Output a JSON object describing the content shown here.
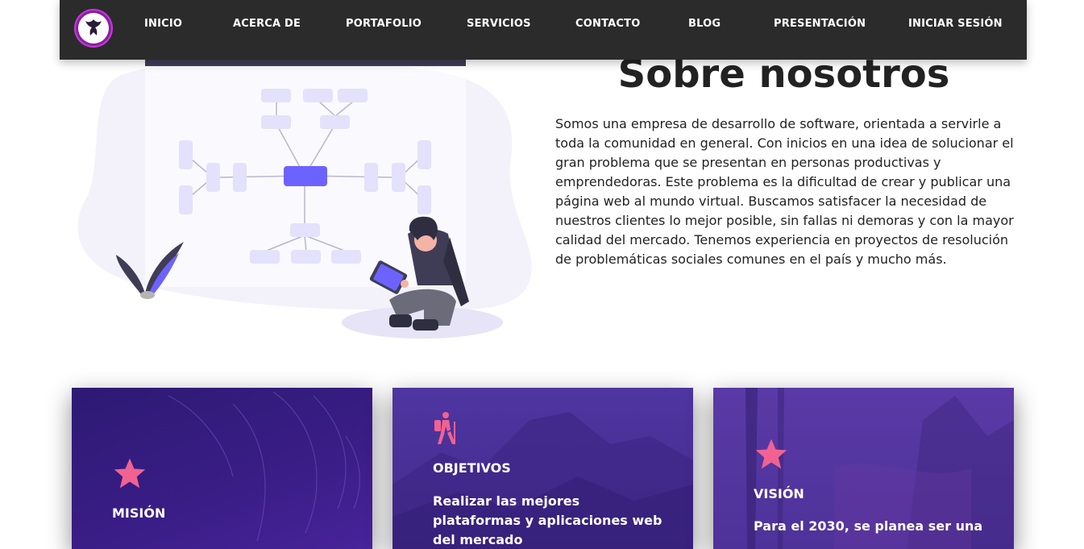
{
  "nav": {
    "items": [
      {
        "label": "INICIO"
      },
      {
        "label": "ACERCA DE"
      },
      {
        "label": "PORTAFOLIO"
      },
      {
        "label": "SERVICIOS"
      },
      {
        "label": "CONTACTO"
      },
      {
        "label": "BLOG"
      },
      {
        "label": "PRESENTACIÓN"
      },
      {
        "label": "INICIAR SESIÓN"
      }
    ]
  },
  "about": {
    "title": "Sobre nosotros",
    "text": "Somos una empresa de desarrollo de software, orientada a servirle a toda la comunidad en general. Con inicios en una idea de solucionar el gran problema que se presentan en personas productivas y emprendedoras. Este problema es la dificultad de crear y publicar una página web al mundo virtual. Buscamos satisfacer la necesidad de nuestros clientes lo mejor posible, sin fallas ni demoras y con la mayor calidad del mercado. Tenemos experiencia en proyectos de resolución de problemáticas sociales comunes en el país y mucho más."
  },
  "cards": {
    "mision": {
      "heading": "MISIÓN",
      "icon": "star-icon"
    },
    "objetivos": {
      "heading": "OBJETIVOS",
      "text": "Realizar las mejores plataformas y aplicaciones web del mercado",
      "icon": "hiker-icon"
    },
    "vision": {
      "heading": "VISIÓN",
      "text": "Para el 2030, se planea ser una",
      "icon": "star-icon"
    }
  },
  "colors": {
    "navbar": "#2b2b2b",
    "accent_icon": "#f06292",
    "card_purple": "#3a1d86",
    "illustration_primary": "#6c63ff"
  }
}
